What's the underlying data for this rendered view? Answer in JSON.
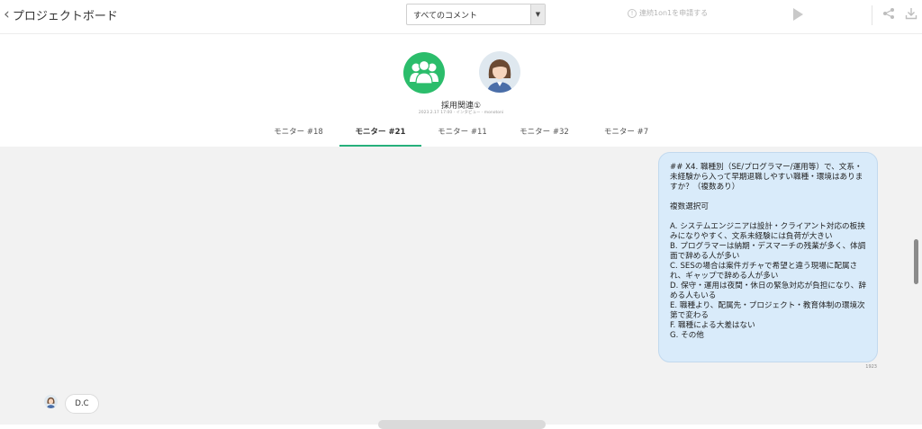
{
  "topbar": {
    "back_label": "プロジェクトボード",
    "filter_selected": "すべてのコメント",
    "request_label": "連続1on1を申請する",
    "icons": [
      "chevron-left-icon",
      "dropdown-arrow-icon",
      "info-icon",
      "play-icon",
      "share-icon",
      "download-icon"
    ]
  },
  "profile": {
    "room_name": "採用関連①",
    "room_sub": "2023.2.17 17:00 · インタビュー · monotoni"
  },
  "tabs": [
    {
      "label": "モニター #18",
      "active": false
    },
    {
      "label": "モニター #21",
      "active": true
    },
    {
      "label": "モニター #11",
      "active": false
    },
    {
      "label": "モニター #32",
      "active": false
    },
    {
      "label": "モニター #7",
      "active": false
    }
  ],
  "message": {
    "text": "## X4. 職種別（SE/プログラマー/運用等）で、文系・未経験から入って早期退職しやすい職種・環境はありますか？（複数あり）\n\n複数選択可\n\nA. システムエンジニアは設計・クライアント対応の板挟みになりやすく、文系未経験には負荷が大きい\nB. プログラマーは納期・デスマーチの残業が多く、体調面で辞める人が多い\nC. SESの場合は案件ガチャで希望と違う現場に配属され、ギャップで辞める人が多い\nD. 保守・運用は夜間・休日の緊急対応が負担になり、辞める人もいる\nE. 職種より、配属先・プロジェクト・教育体制の環境次第で変わる\nF. 職種による大差はない\nG. その他",
    "char_count": "1923"
  },
  "user": {
    "name": "D.C"
  },
  "colors": {
    "accent": "#27b07b",
    "group_avatar": "#2bbd6b",
    "bubble": "#d9ebfa",
    "chat_bg": "#f2f2f2"
  }
}
